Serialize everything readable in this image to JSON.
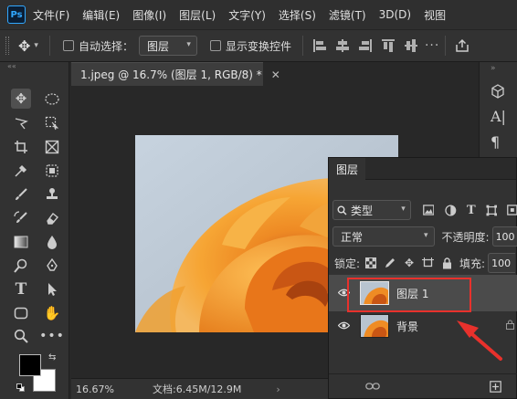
{
  "menubar": {
    "logo": "Ps",
    "items": [
      "文件(F)",
      "编辑(E)",
      "图像(I)",
      "图层(L)",
      "文字(Y)",
      "选择(S)",
      "滤镜(T)",
      "3D(D)",
      "视图"
    ]
  },
  "options": {
    "auto_select_label": "自动选择：",
    "auto_select_value": "图层",
    "show_transform_label": "显示变换控件"
  },
  "document": {
    "tab_title": "1.jpeg @ 16.7% (图层 1, RGB/8) *",
    "zoom": "16.67%",
    "doc_info": "文档:6.45M/12.9M"
  },
  "layers_panel": {
    "tab": "图层",
    "filter_kind": "类型",
    "blend_mode": "正常",
    "opacity_label": "不透明度:",
    "opacity_value": "100",
    "lock_label": "锁定:",
    "fill_label": "填充:",
    "fill_value": "100",
    "layers": [
      {
        "name": "图层 1",
        "selected": true
      },
      {
        "name": "背景",
        "selected": false
      }
    ]
  },
  "colors": {
    "accent_red": "#e8312c",
    "ps_blue": "#31a8ff",
    "rose_orange": "#f5a02a"
  }
}
